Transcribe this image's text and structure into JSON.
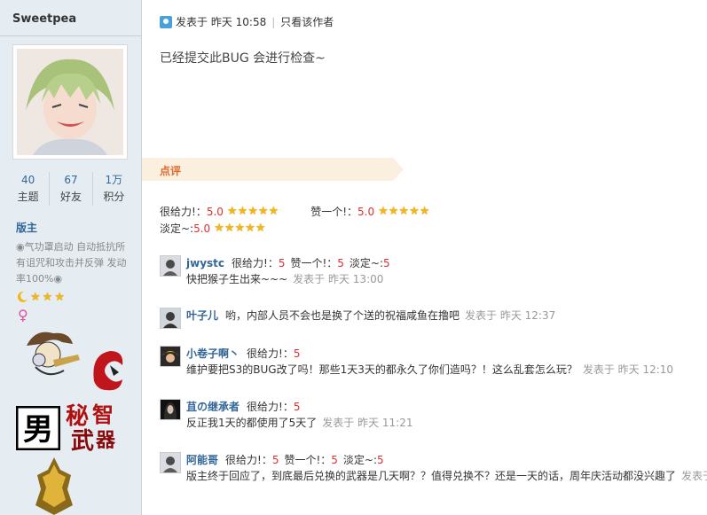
{
  "author": {
    "name": "Sweetpea",
    "stats": [
      {
        "num": "40",
        "label": "主题"
      },
      {
        "num": "67",
        "label": "好友"
      },
      {
        "num": "1万",
        "label": "积分"
      }
    ],
    "role": "版主",
    "bio": "◉气功罩启动 自动抵抗所有诅咒和攻击并反弹 发动率100%◉"
  },
  "post": {
    "posted": "发表于 昨天 10:58",
    "only_author": "只看该作者",
    "body": "已经提交此BUG  会进行检查~"
  },
  "rating": {
    "title": "点评",
    "items": [
      {
        "label": "很给力!：",
        "score": "5.0"
      },
      {
        "label": "赞一个!：",
        "score": "5.0"
      },
      {
        "label": "淡定~:",
        "score": "5.0"
      }
    ]
  },
  "comments": [
    {
      "name": "jwystc",
      "ratings": [
        {
          "label": "很给力!：",
          "v": "5"
        },
        {
          "label": "赞一个!：",
          "v": "5"
        },
        {
          "label": "淡定~:",
          "v": "5"
        }
      ],
      "text": "快把猴子生出来~~~",
      "time": "发表于 昨天 13:00"
    },
    {
      "name": "叶子儿",
      "ratings": [],
      "text": "哟，内部人员不会也是换了个送的祝福咸鱼在撸吧",
      "time": "发表于 昨天 12:37"
    },
    {
      "name": "小卷子啊丶",
      "ratings": [
        {
          "label": "很给力!：",
          "v": "5"
        }
      ],
      "text": "维护要把S3的BUG改了吗！那些1天3天的都永久了你们造吗？！这么乱套怎么玩？",
      "time": "发表于 昨天 12:10"
    },
    {
      "name": "苴の继承者",
      "ratings": [
        {
          "label": "很给力!：",
          "v": "5"
        }
      ],
      "text": "反正我1天的都使用了5天了",
      "time": "发表于 昨天 11:21"
    },
    {
      "name": "阿能哥",
      "ratings": [
        {
          "label": "很给力!：",
          "v": "5"
        },
        {
          "label": "赞一个!：",
          "v": "5"
        },
        {
          "label": "淡定~:",
          "v": "5"
        }
      ],
      "text": "版主终于回应了，到底最后兑换的武器是几天啊？？值得兑换不？还是一天的话，周年庆活动都没兴趣了",
      "time": "发表于"
    }
  ],
  "colors": {
    "link": "#336699",
    "score": "#e0302f",
    "rate_title": "#e06a2f",
    "star": "#f2b51a"
  },
  "icons": [
    "post-icon",
    "star-icon",
    "medal-icon",
    "female-icon"
  ]
}
